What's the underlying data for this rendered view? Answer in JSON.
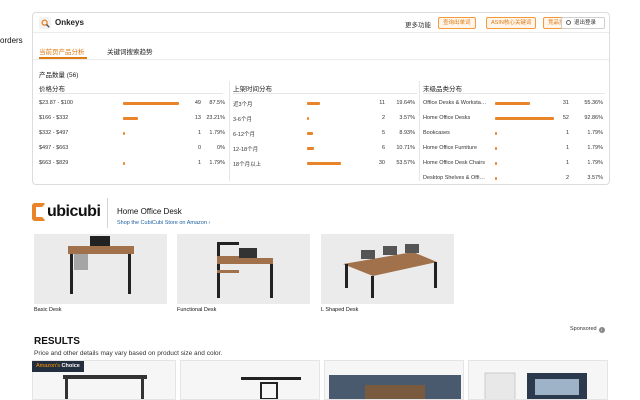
{
  "left_edge": {
    "text": "orders"
  },
  "panel": {
    "brand": "Onkeys",
    "more_label": "更多功能",
    "buttons": [
      "查询出单词",
      "ASIN核心关键词",
      "竞品搜同款"
    ],
    "logout_label": "退出登录",
    "tabs": [
      {
        "label": "当前页产品分析",
        "active": true
      },
      {
        "label": "关键词搜索趋势",
        "active": false
      }
    ],
    "product_count_label": "产品数量 (56)",
    "accent_color": "#e8842a",
    "price": {
      "title": "价格分布",
      "rows": [
        {
          "label": "$23.87 - $100",
          "count": "49",
          "pct": "87.5%",
          "fill": 0.875
        },
        {
          "label": "$166 - $332",
          "count": "13",
          "pct": "23.21%",
          "fill": 0.2321
        },
        {
          "label": "$332 - $497",
          "count": "1",
          "pct": "1.79%",
          "fill": 0.0179
        },
        {
          "label": "$497 - $663",
          "count": "0",
          "pct": "0%",
          "fill": 0
        },
        {
          "label": "$663 - $829",
          "count": "1",
          "pct": "1.79%",
          "fill": 0.0179
        }
      ]
    },
    "listing_time": {
      "title": "上架时间分布",
      "rows": [
        {
          "label": "近3个月",
          "count": "11",
          "pct": "19.64%",
          "fill": 0.1964
        },
        {
          "label": "3-6个月",
          "count": "2",
          "pct": "3.57%",
          "fill": 0.0357
        },
        {
          "label": "6-12个月",
          "count": "5",
          "pct": "8.93%",
          "fill": 0.0893
        },
        {
          "label": "12-18个月",
          "count": "6",
          "pct": "10.71%",
          "fill": 0.1071
        },
        {
          "label": "18个月以上",
          "count": "30",
          "pct": "53.57%",
          "fill": 0.5357
        }
      ]
    },
    "category": {
      "title": "末级品类分布",
      "rows": [
        {
          "label": "Office Desks & Worksta…",
          "count": "31",
          "pct": "55.36%",
          "fill": 0.5536
        },
        {
          "label": "Home Office Desks",
          "count": "52",
          "pct": "92.86%",
          "fill": 0.9286
        },
        {
          "label": "Bookcases",
          "count": "1",
          "pct": "1.79%",
          "fill": 0.0179
        },
        {
          "label": "Home Office Furniture",
          "count": "1",
          "pct": "1.79%",
          "fill": 0.0179
        },
        {
          "label": "Home Office Desk Chairs",
          "count": "1",
          "pct": "1.79%",
          "fill": 0.0179
        },
        {
          "label": "Desktop Shelves & Offi…",
          "count": "2",
          "pct": "3.57%",
          "fill": 0.0357
        }
      ]
    }
  },
  "sponsored_brand": {
    "logo_text": "ubicubi",
    "title": "Home Office Desk",
    "store_link": "Shop the CubiCubi Store on Amazon ›",
    "products": [
      "Basic Desk",
      "Functional Desk",
      "L Shaped Desk"
    ],
    "sponsored_label": "Sponsored"
  },
  "results": {
    "title": "RESULTS",
    "subtitle": "Price and other details may vary based on product size and color.",
    "badge_prefix": "Amazon's",
    "badge_suffix": "Choice"
  }
}
